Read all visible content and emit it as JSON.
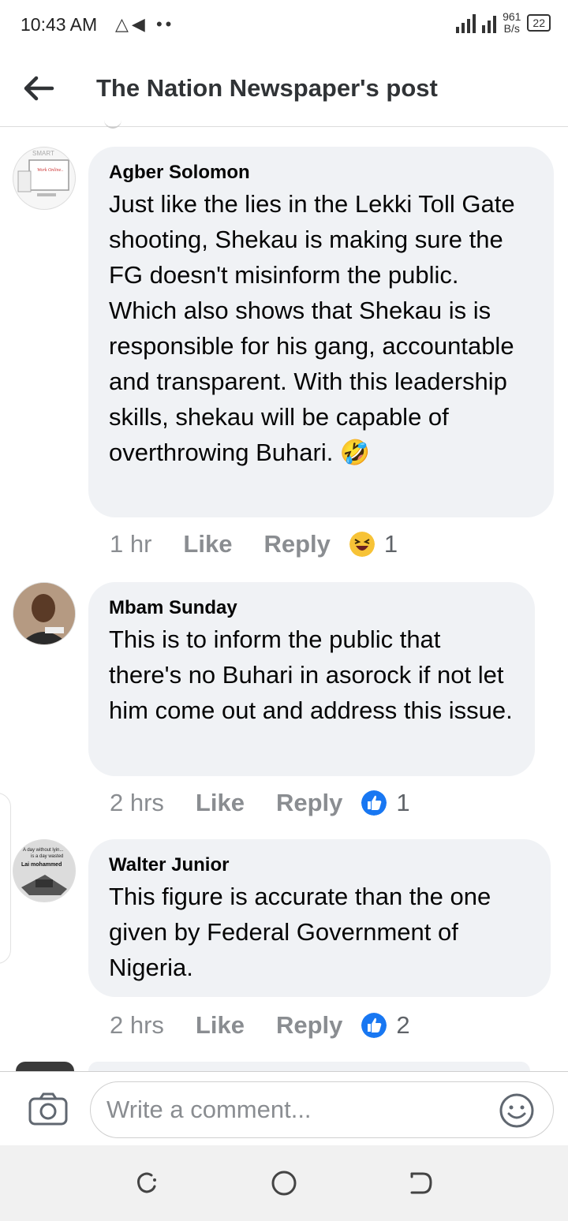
{
  "status_bar": {
    "time": "10:43 AM",
    "icons": "△◀ ••",
    "net_speed_value": "961",
    "net_speed_unit": "B/s",
    "battery": "22"
  },
  "header": {
    "title": "The Nation Newspaper's post"
  },
  "comments": [
    {
      "author": "Agber Solomon",
      "text": "Just like the lies in the Lekki Toll Gate shooting, Shekau is making sure the FG doesn't misinform the public. Which also shows that Shekau is is responsible for his gang, accountable and transparent. With this leadership skills, shekau will be capable of overthrowing Buhari. 🤣",
      "time": "1 hr",
      "like_label": "Like",
      "reply_label": "Reply",
      "reaction_icon": "laugh-icon",
      "reaction_count": "1"
    },
    {
      "author": "Mbam Sunday",
      "text": "This is to inform the public that there's no Buhari in asorock if not let him come out and address this issue.",
      "time": "2 hrs",
      "like_label": "Like",
      "reply_label": "Reply",
      "reaction_icon": "thumbs-up-icon",
      "reaction_count": "1"
    },
    {
      "author": "Walter Junior",
      "text": "This figure is accurate than the one given by Federal Government of Nigeria.",
      "time": "2 hrs",
      "like_label": "Like",
      "reply_label": "Reply",
      "reaction_icon": "thumbs-up-icon",
      "reaction_count": "2"
    }
  ],
  "avatars": {
    "agber": {
      "line1": "SMART",
      "line2": "Work Online.."
    },
    "walter": {
      "line1": "A day without lyin...",
      "line2": "is a day wasted",
      "line3": "Lai mohammed"
    }
  },
  "composer": {
    "placeholder": "Write a comment..."
  },
  "colors": {
    "bubble": "#f0f2f5",
    "like_blue": "#1877f2",
    "muted_text": "#8a8d91"
  }
}
